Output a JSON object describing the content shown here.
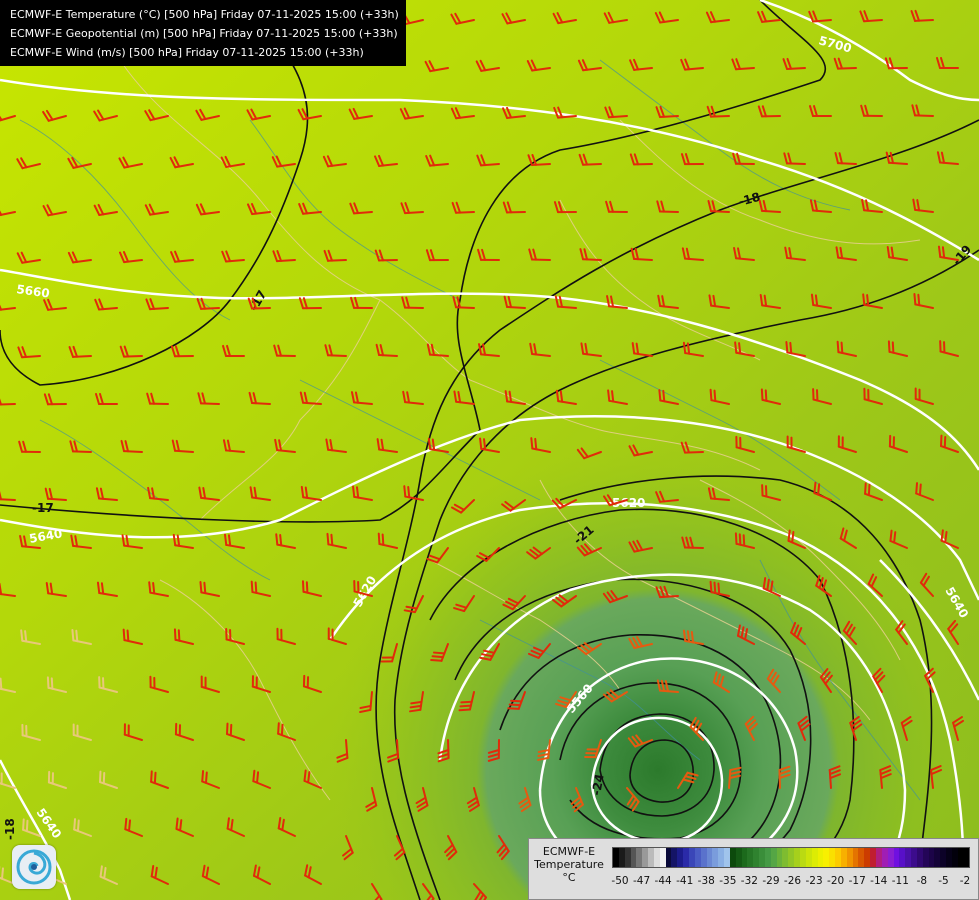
{
  "header": {
    "lines": [
      "ECMWF-E Temperature (°C) [500 hPa] Friday 07-11-2025 15:00 (+33h)",
      "ECMWF-E Geopotential (m) [500 hPa] Friday 07-11-2025 15:00 (+33h)",
      "ECMWF-E Wind (m/s) [500 hPa] Friday 07-11-2025 15:00 (+33h)"
    ]
  },
  "map": {
    "geopotential_labels": [
      "5700",
      "5660",
      "5640",
      "5620",
      "5620",
      "5560",
      "5640",
      "5640"
    ],
    "temperature_labels": [
      "-18",
      "-19",
      "-17",
      "-17",
      "-18",
      "-21",
      "-24",
      "-18"
    ]
  },
  "colorbar": {
    "title_line1": "ECMWF-E",
    "title_line2": "Temperature",
    "unit": "°C",
    "ticks": [
      "-50",
      "-47",
      "-44",
      "-41",
      "-38",
      "-35",
      "-32",
      "-29",
      "-26",
      "-23",
      "-20",
      "-17",
      "-14",
      "-11",
      "-8",
      "-5",
      "-2"
    ],
    "colors": [
      "#000000",
      "#1a1a1a",
      "#333333",
      "#555555",
      "#777777",
      "#999999",
      "#bbbbbb",
      "#dddddd",
      "#f2f2f2",
      "#0a0a3a",
      "#141466",
      "#1c1c8c",
      "#2a2aa8",
      "#3a46b8",
      "#4a5cc4",
      "#5a72cc",
      "#6a88d4",
      "#7a9cdc",
      "#8ab0e4",
      "#a0c4ec",
      "#0c4a0c",
      "#145a14",
      "#1c6a1c",
      "#267626",
      "#2f822f",
      "#3a8e3a",
      "#459a45",
      "#55a645",
      "#6ab23a",
      "#7ebc30",
      "#92c626",
      "#a6d01c",
      "#bada12",
      "#cce40a",
      "#dcec04",
      "#ecf000",
      "#f8f000",
      "#fae000",
      "#fccc00",
      "#f8b000",
      "#f09400",
      "#e47400",
      "#d85800",
      "#cc3c00",
      "#c01e30",
      "#b01e80",
      "#a01eb4",
      "#8a1ed2",
      "#7010e0",
      "#5810c8",
      "#4a10a8",
      "#3c0c8c",
      "#300870",
      "#240558",
      "#1c0448",
      "#140338",
      "#0c0228",
      "#060118",
      "#02000c",
      "#000000",
      "#000000"
    ]
  },
  "logo": {
    "icon": "ecmwf-swirl-logo"
  }
}
